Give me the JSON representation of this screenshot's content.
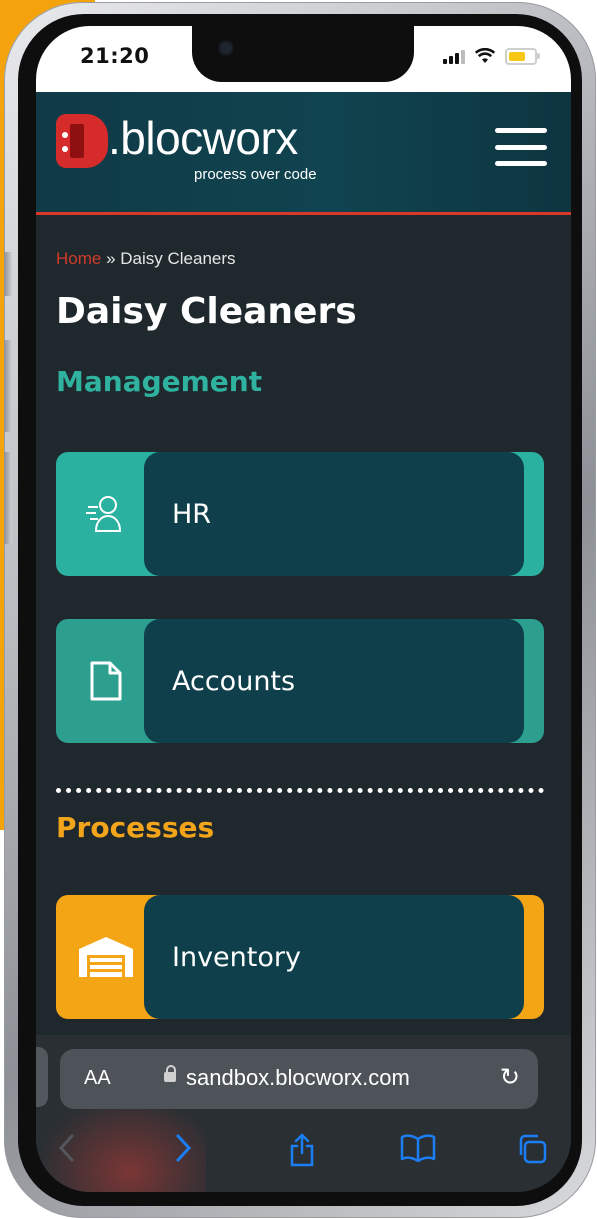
{
  "status_bar": {
    "time": "21:20",
    "signal_icon": "cellular-signal-icon",
    "wifi_icon": "wifi-icon",
    "battery_icon": "battery-icon"
  },
  "header": {
    "logo_text": ".blocworx",
    "logo_tagline": "process over code",
    "menu_icon": "hamburger-menu-icon"
  },
  "breadcrumb": {
    "home": "Home",
    "separator": " » ",
    "current": "Daisy Cleaners"
  },
  "page_title": "Daisy Cleaners",
  "sections": {
    "management": {
      "title": "Management",
      "tiles": [
        {
          "label": "HR",
          "icon": "person-profile-icon"
        },
        {
          "label": "Accounts",
          "icon": "document-icon"
        }
      ]
    },
    "processes": {
      "title": "Processes",
      "tiles": [
        {
          "label": "Inventory",
          "icon": "warehouse-icon"
        }
      ]
    }
  },
  "browser": {
    "text_size_label": "AA",
    "url": "sandbox.blocworx.com",
    "icons": {
      "lock": "lock-icon",
      "reload": "reload-icon",
      "back": "back-chevron-icon",
      "forward": "forward-chevron-icon",
      "share": "share-icon",
      "bookmarks": "bookmarks-icon",
      "tabs": "tabs-icon"
    }
  },
  "colors": {
    "accent_red": "#d9382b",
    "teal": "#2bb1a0",
    "orange": "#f4a516",
    "header_bg": "#0f3a46",
    "tile_body": "#0f3f4b"
  }
}
